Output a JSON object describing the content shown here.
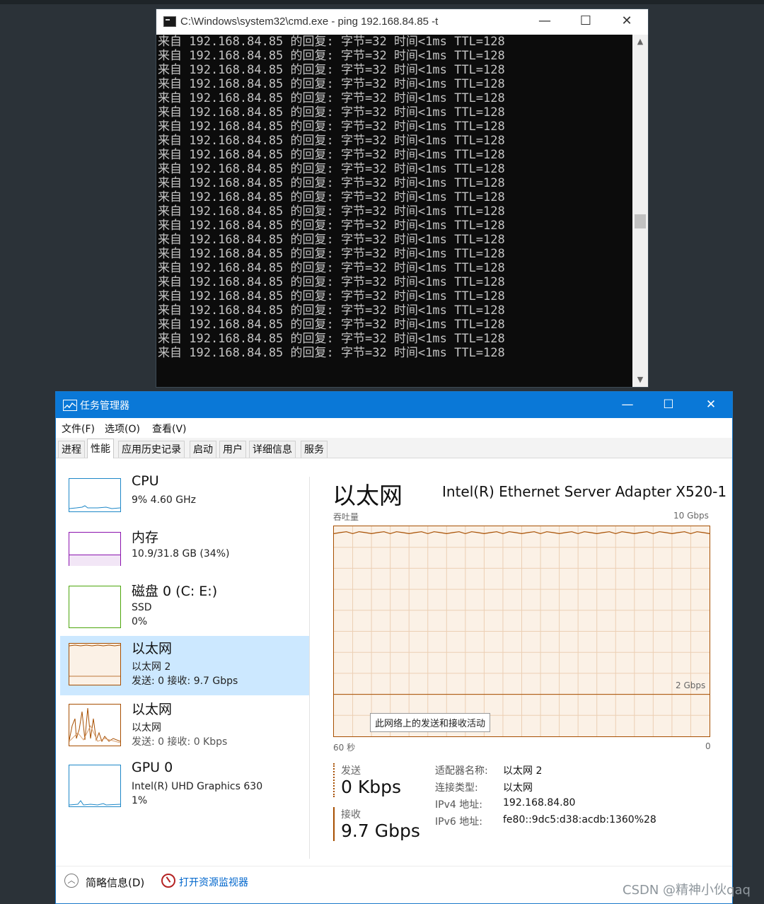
{
  "cmd": {
    "title": "C:\\Windows\\system32\\cmd.exe - ping  192.168.84.85 -t",
    "controls": {
      "minimize": "—",
      "maximize": "☐",
      "close": "✕"
    },
    "lines": [
      "来自 192.168.84.85 的回复: 字节=32 时间<1ms TTL=128",
      "来自 192.168.84.85 的回复: 字节=32 时间<1ms TTL=128",
      "来自 192.168.84.85 的回复: 字节=32 时间<1ms TTL=128",
      "来自 192.168.84.85 的回复: 字节=32 时间<1ms TTL=128",
      "来自 192.168.84.85 的回复: 字节=32 时间<1ms TTL=128",
      "来自 192.168.84.85 的回复: 字节=32 时间<1ms TTL=128",
      "来自 192.168.84.85 的回复: 字节=32 时间<1ms TTL=128",
      "来自 192.168.84.85 的回复: 字节=32 时间<1ms TTL=128",
      "来自 192.168.84.85 的回复: 字节=32 时间<1ms TTL=128",
      "来自 192.168.84.85 的回复: 字节=32 时间<1ms TTL=128",
      "来自 192.168.84.85 的回复: 字节=32 时间<1ms TTL=128",
      "来自 192.168.84.85 的回复: 字节=32 时间<1ms TTL=128",
      "来自 192.168.84.85 的回复: 字节=32 时间<1ms TTL=128",
      "来自 192.168.84.85 的回复: 字节=32 时间<1ms TTL=128",
      "来自 192.168.84.85 的回复: 字节=32 时间<1ms TTL=128",
      "来自 192.168.84.85 的回复: 字节=32 时间<1ms TTL=128",
      "来自 192.168.84.85 的回复: 字节=32 时间<1ms TTL=128",
      "来自 192.168.84.85 的回复: 字节=32 时间<1ms TTL=128",
      "来自 192.168.84.85 的回复: 字节=32 时间<1ms TTL=128",
      "来自 192.168.84.85 的回复: 字节=32 时间<1ms TTL=128",
      "来自 192.168.84.85 的回复: 字节=32 时间<1ms TTL=128",
      "来自 192.168.84.85 的回复: 字节=32 时间<1ms TTL=128",
      "来自 192.168.84.85 的回复: 字节=32 时间<1ms TTL=128"
    ]
  },
  "taskmgr": {
    "title": "任务管理器",
    "controls": {
      "minimize": "—",
      "maximize": "☐",
      "close": "✕"
    },
    "menu": {
      "file": "文件(F)",
      "options": "选项(O)",
      "view": "查看(V)"
    },
    "tabs": [
      "进程",
      "性能",
      "应用历史记录",
      "启动",
      "用户",
      "详细信息",
      "服务"
    ],
    "active_tab": "性能",
    "list": {
      "cpu": {
        "title": "CPU",
        "sub1": "9% 4.60 GHz"
      },
      "mem": {
        "title": "内存",
        "sub1": "10.9/31.8 GB (34%)"
      },
      "disk": {
        "title": "磁盘 0 (C: E:)",
        "sub1": "SSD",
        "sub2": "0%"
      },
      "eth2": {
        "title": "以太网",
        "sub1": "以太网 2",
        "sub2": "发送: 0 接收: 9.7 Gbps"
      },
      "eth": {
        "title": "以太网",
        "sub1": "以太网",
        "sub2": "发送: 0 接收: 0 Kbps"
      },
      "gpu": {
        "title": "GPU 0",
        "sub1": "Intel(R) UHD Graphics 630",
        "sub2": "1%"
      }
    },
    "panel": {
      "title": "以太网",
      "adapter": "Intel(R) Ethernet Server Adapter X520-1",
      "throughput_label": "吞吐量",
      "max_label": "10 Gbps",
      "mid_label": "2 Gbps",
      "time_left": "60 秒",
      "time_right": "0",
      "tooltip": "此网络上的发送和接收活动",
      "send_label": "发送",
      "send_value": "0 Kbps",
      "recv_label": "接收",
      "recv_value": "9.7 Gbps",
      "details": {
        "adapter_name_key": "适配器名称:",
        "adapter_name": "以太网 2",
        "conn_type_key": "连接类型:",
        "conn_type": "以太网",
        "ipv4_key": "IPv4 地址:",
        "ipv4": "192.168.84.80",
        "ipv6_key": "IPv6 地址:",
        "ipv6": "fe80::9dc5:d38:acdb:1360%28"
      }
    },
    "footer": {
      "fold": "简略信息(D)",
      "resmon": "打开资源监视器"
    },
    "colors": {
      "titlebar": "#0a78d7",
      "eth_line": "#a74f01",
      "eth_fill": "#fbf1e6",
      "selected": "#cce8ff",
      "cpu": "#1e88c8",
      "mem": "#8b12ae",
      "disk": "#4da60c"
    }
  },
  "watermark": "CSDN @精神小伙qaq"
}
